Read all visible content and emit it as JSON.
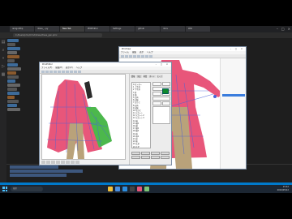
{
  "browser": {
    "tabs": [
      {
        "label": "iamgoldtip"
      },
      {
        "label": "dress_...py"
      },
      {
        "label": "New Tab",
        "active": true
      },
      {
        "label": "PMXEditor"
      },
      {
        "label": "Settings"
      },
      {
        "label": "github"
      },
      {
        "label": "docs"
      },
      {
        "label": "Wiki"
      }
    ],
    "url": "C:/Users/pmx/mmd/dress/dress_gen.pmx"
  },
  "back_window": {
    "title": "PmxView",
    "menus": [
      "ファイル",
      "編集",
      "表示",
      "ヘルプ"
    ]
  },
  "front_window": {
    "title": "PmxEditor",
    "menus": [
      "ファイル(F)",
      "編集(E)",
      "表示(V)",
      "ヘルプ"
    ],
    "panel_tabs": [
      "情報",
      "頂点",
      "材質",
      "ボーン",
      "モーフ"
    ],
    "list_items": [
      "0 センター",
      "1 上半身",
      "2 下半身",
      "3 首",
      "4 頭",
      "5 左肩",
      "6 左腕",
      "7 左ひじ",
      "8 右肩",
      "9 右腕",
      "10 右ひじ",
      "11 スカート",
      "12 スカート2",
      "13 スカート3",
      "14 袖",
      "15 袖2",
      "16 裾",
      "17 裾2",
      "18 裾3",
      "19 帯",
      "20 帯2",
      "21 前",
      "22 後",
      "23 左足",
      "24 右足"
    ]
  },
  "taskbar": {
    "search_placeholder": "検索",
    "time": "15:42",
    "date": "2024/05/12"
  },
  "colors": {
    "dress_pink": "#e8567a",
    "skirt_green": "#4cb84c",
    "pants_tan": "#b9a27a",
    "bone_blue": "#4a63d8",
    "accent_green": "#0f8a2d",
    "vscode_blue": "#007acc"
  }
}
